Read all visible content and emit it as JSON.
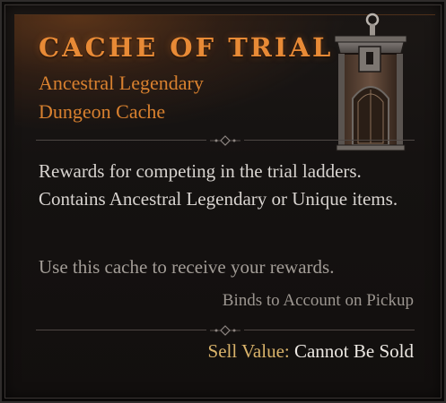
{
  "item": {
    "name": "CACHE OF TRIAL",
    "quality_line1": "Ancestral Legendary",
    "quality_line2": "Dungeon Cache",
    "icon": "cache-chest-icon",
    "description": "Rewards for competing in the trial ladders. Contains Ancestral Legendary or Unique items.",
    "usage": "Use this cache to receive your rewards.",
    "binding": "Binds to Account on Pickup",
    "sell_label": "Sell Value:",
    "sell_value": "Cannot Be Sold"
  },
  "colors": {
    "title": "#e88a36",
    "quality": "#d9812f",
    "sell_label": "#d9b36a",
    "body_text": "#d8d4d0",
    "muted_text": "#a39d97"
  }
}
